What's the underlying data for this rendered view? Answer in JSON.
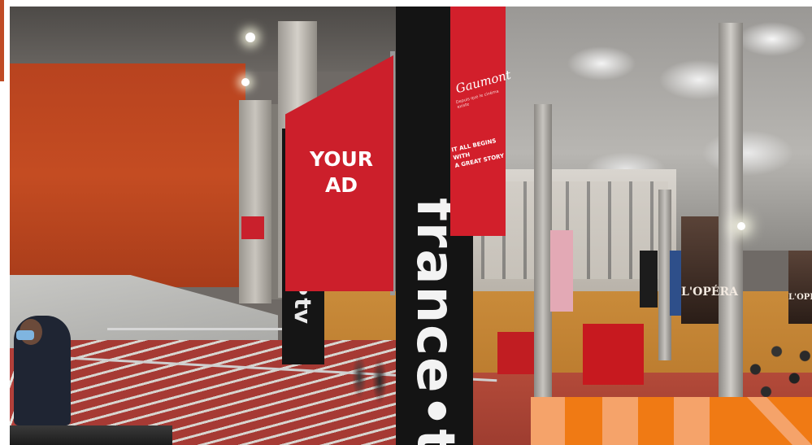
{
  "photo": {
    "ad_placeholder": {
      "line1": "YOUR",
      "line2": "AD"
    },
    "pillar_brand": "france•tv",
    "gaumont_banner": {
      "logo": "Gaumont",
      "sub": "Depuis que le cinéma existe",
      "tagline_line1": "IT ALL BEGINS WITH",
      "tagline_line2": "A GREAT STORY"
    },
    "opera_poster_1": "L'OPÉRA",
    "opera_poster_2": "L'OPÉRA"
  },
  "colors": {
    "ad_red": "#cc1f2b",
    "brand_orange": "#f07a14",
    "stripe_light": "#f5a36a"
  }
}
